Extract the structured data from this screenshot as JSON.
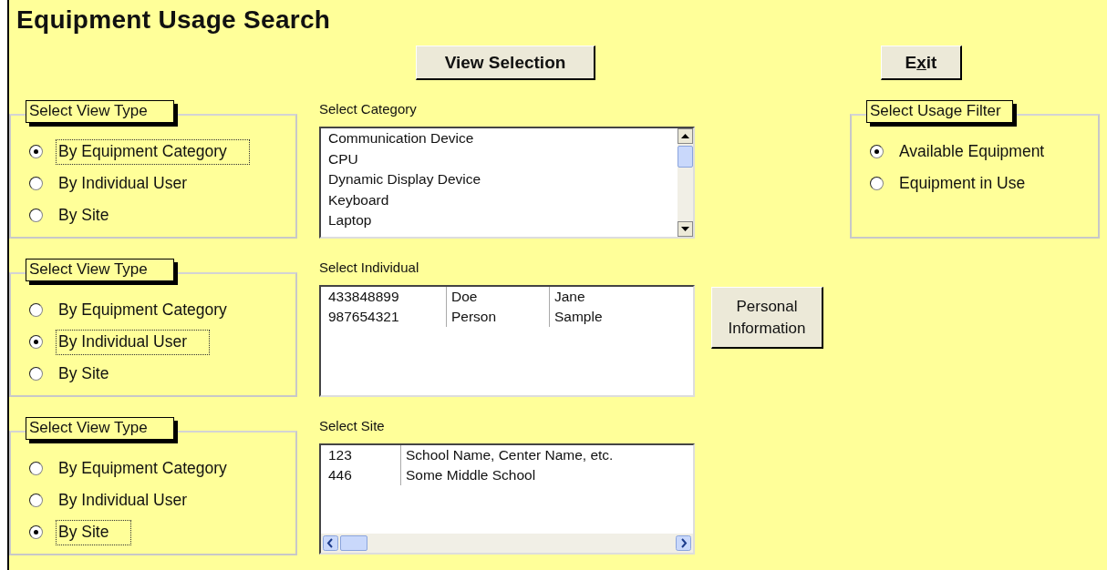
{
  "title": "Equipment Usage Search",
  "view_selection_button": {
    "label": "View Selection"
  },
  "exit_button": {
    "label_parts": [
      {
        "text": "E",
        "underline": false
      },
      {
        "text": "x",
        "underline": true
      },
      {
        "text": "it",
        "underline": false
      }
    ]
  },
  "rows": [
    {
      "view_type": {
        "legend": "Select View Type",
        "options": [
          {
            "label": "By Equipment Category",
            "selected": true,
            "focused": true
          },
          {
            "label": "By Individual User",
            "selected": false,
            "focused": false
          },
          {
            "label": "By Site",
            "selected": false,
            "focused": false
          }
        ]
      },
      "list": {
        "label": "Select Category",
        "kind": "single",
        "vertical_scrollbar": true,
        "items": [
          "Communication Device",
          "CPU",
          "Dynamic Display Device",
          "Keyboard",
          "Laptop"
        ]
      }
    },
    {
      "view_type": {
        "legend": "Select View Type",
        "options": [
          {
            "label": "By Equipment Category",
            "selected": false,
            "focused": false
          },
          {
            "label": "By Individual User",
            "selected": true,
            "focused": true
          },
          {
            "label": "By Site",
            "selected": false,
            "focused": false
          }
        ]
      },
      "list": {
        "label": "Select Individual",
        "kind": "columns",
        "rows": [
          [
            "433848899",
            "Doe",
            "Jane"
          ],
          [
            "987654321",
            "Person",
            "Sample"
          ]
        ]
      },
      "side_button": {
        "label": "Personal Information"
      }
    },
    {
      "view_type": {
        "legend": "Select View Type",
        "options": [
          {
            "label": "By Equipment Category",
            "selected": false,
            "focused": false
          },
          {
            "label": "By Individual User",
            "selected": false,
            "focused": false
          },
          {
            "label": "By Site",
            "selected": true,
            "focused": true
          }
        ]
      },
      "list": {
        "label": "Select Site",
        "kind": "columns",
        "horizontal_scrollbar": true,
        "rows": [
          [
            "123",
            "School Name, Center Name, etc."
          ],
          [
            "446",
            "Some Middle School"
          ]
        ]
      }
    }
  ],
  "usage_filter": {
    "legend": "Select Usage Filter",
    "options": [
      {
        "label": "Available Equipment",
        "selected": true,
        "focused": false
      },
      {
        "label": "Equipment in Use",
        "selected": false,
        "focused": false
      }
    ]
  }
}
